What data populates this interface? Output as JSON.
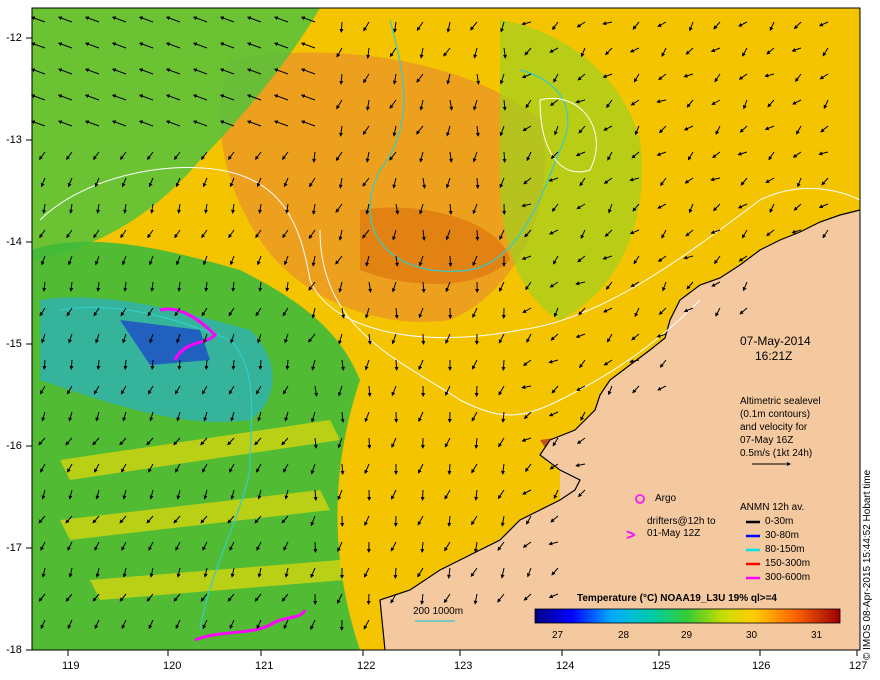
{
  "map": {
    "lat_labels": [
      "-12",
      "-13",
      "-14",
      "-15",
      "-16",
      "-17",
      "-18"
    ],
    "lon_labels": [
      "119",
      "120",
      "121",
      "122",
      "123",
      "124",
      "125",
      "126",
      "127"
    ],
    "date_line1": "07-May-2014",
    "date_line2": "16:21Z",
    "altimetry_lines": [
      "Altimetric sealevel",
      "(0.1m contours)",
      "and velocity for",
      "07-May 16Z",
      "0.5m/s (1kt 24h)"
    ],
    "argo_label": "Argo",
    "drifters_lines": [
      "drifters@12h to",
      "01-May 12Z"
    ],
    "anmn_title": "ANMN 12h av.",
    "anmn_items": [
      {
        "label": "0-30m",
        "color": "#000000"
      },
      {
        "label": "30-80m",
        "color": "#0000ff"
      },
      {
        "label": "80-150m",
        "color": "#00e5e5"
      },
      {
        "label": "150-300m",
        "color": "#ff0000"
      },
      {
        "label": "300-600m",
        "color": "#ff00ff"
      }
    ],
    "isobath_label": "200  1000m",
    "colorbar_title": "Temperature (°C) NOAA19_L3U 19% ql>=4",
    "colorbar_ticks": [
      "27",
      "28",
      "29",
      "30",
      "31"
    ],
    "credit": "© IMOS 08-Apr-2015 15:44:52 Hobart time",
    "colors": {
      "land": "#f5c9a0",
      "isobath": "#33cccc",
      "contour": "#ffffff",
      "drifter": "#ff00ff"
    }
  }
}
